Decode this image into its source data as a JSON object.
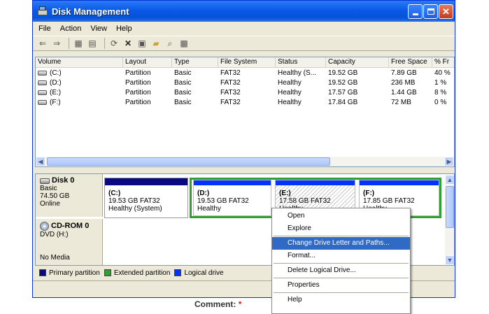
{
  "window": {
    "title": "Disk Management",
    "icon": "disk-management-icon"
  },
  "menu": [
    "File",
    "Action",
    "View",
    "Help"
  ],
  "toolbar_icons": [
    "back-arrow-icon",
    "forward-arrow-icon",
    "console-tree-icon",
    "properties-icon",
    "refresh-icon",
    "delete-icon",
    "new-icon",
    "open-folder-icon",
    "search-icon",
    "help-icon"
  ],
  "volume_list": {
    "columns": [
      "Volume",
      "Layout",
      "Type",
      "File System",
      "Status",
      "Capacity",
      "Free Space",
      "% Fr"
    ],
    "rows": [
      [
        "(C:)",
        "Partition",
        "Basic",
        "FAT32",
        "Healthy (S...",
        "19.52 GB",
        "7.89 GB",
        "40 %"
      ],
      [
        "(D:)",
        "Partition",
        "Basic",
        "FAT32",
        "Healthy",
        "19.52 GB",
        "236 MB",
        "1 %"
      ],
      [
        "(E:)",
        "Partition",
        "Basic",
        "FAT32",
        "Healthy",
        "17.57 GB",
        "1.44 GB",
        "8 %"
      ],
      [
        "(F:)",
        "Partition",
        "Basic",
        "FAT32",
        "Healthy",
        "17.84 GB",
        "72 MB",
        "0 %"
      ]
    ]
  },
  "disk0": {
    "name": "Disk 0",
    "type": "Basic",
    "size": "74.50 GB",
    "state": "Online",
    "partitions": [
      {
        "name": "(C:)",
        "size": "19.53 GB FAT32",
        "status": "Healthy (System)"
      },
      {
        "name": "(D:)",
        "size": "19.53 GB FAT32",
        "status": "Healthy"
      },
      {
        "name": "(E:)",
        "size": "17.58 GB FAT32",
        "status": "Healthy"
      },
      {
        "name": "(F:)",
        "size": "17.85 GB FAT32",
        "status": "Healthy"
      }
    ]
  },
  "cdrom": {
    "name": "CD-ROM 0",
    "drive": "DVD (H:)",
    "media": "No Media"
  },
  "legend": [
    "Primary partition",
    "Extended partition",
    "Logical drive"
  ],
  "colors": {
    "primary": "#0a0a80",
    "extended": "#30a030",
    "logical": "#0033ff",
    "selection": "#316ac5"
  },
  "context_menu": {
    "items": [
      "Open",
      "Explore",
      "Change Drive Letter and Paths...",
      "Format...",
      "Delete Logical Drive...",
      "Properties",
      "Help"
    ],
    "selected": "Change Drive Letter and Paths..."
  },
  "comment": {
    "label": "Comment:",
    "required_mark": "*"
  }
}
